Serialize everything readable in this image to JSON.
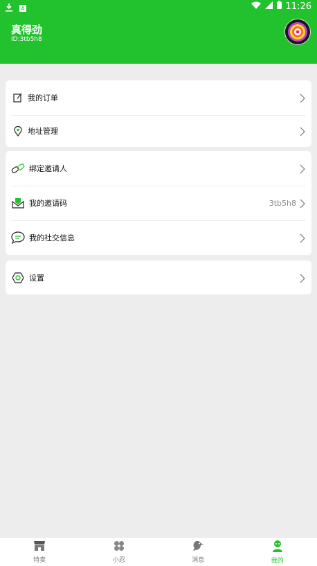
{
  "status_bar": {
    "time": "11:26",
    "left_icons": [
      "download-icon",
      "a-icon"
    ],
    "right_icons": [
      "wifi-icon",
      "signal-icon",
      "battery-icon"
    ]
  },
  "profile": {
    "name": "真得劲",
    "id": "ID:3tb5h8"
  },
  "menu_groups": [
    {
      "items": [
        {
          "label": "我的订单",
          "icon": "edit-order-icon"
        },
        {
          "label": "地址管理",
          "icon": "location-pin-icon"
        }
      ]
    },
    {
      "items": [
        {
          "label": "绑定邀请人",
          "icon": "link-icon"
        },
        {
          "label": "我的邀请码",
          "icon": "envelope-icon",
          "value": "3tb5h8"
        },
        {
          "label": "我的社交信息",
          "icon": "chat-bubble-icon"
        }
      ]
    },
    {
      "items": [
        {
          "label": "设置",
          "icon": "settings-icon"
        }
      ]
    }
  ],
  "tabs": [
    {
      "label": "特卖",
      "icon": "store-icon"
    },
    {
      "label": "小忍",
      "icon": "clover-icon"
    },
    {
      "label": "消息",
      "icon": "bird-icon"
    },
    {
      "label": "我的",
      "icon": "person-icon",
      "active": true
    }
  ],
  "colors": {
    "brand": "#22c22e",
    "background": "#ededed"
  }
}
